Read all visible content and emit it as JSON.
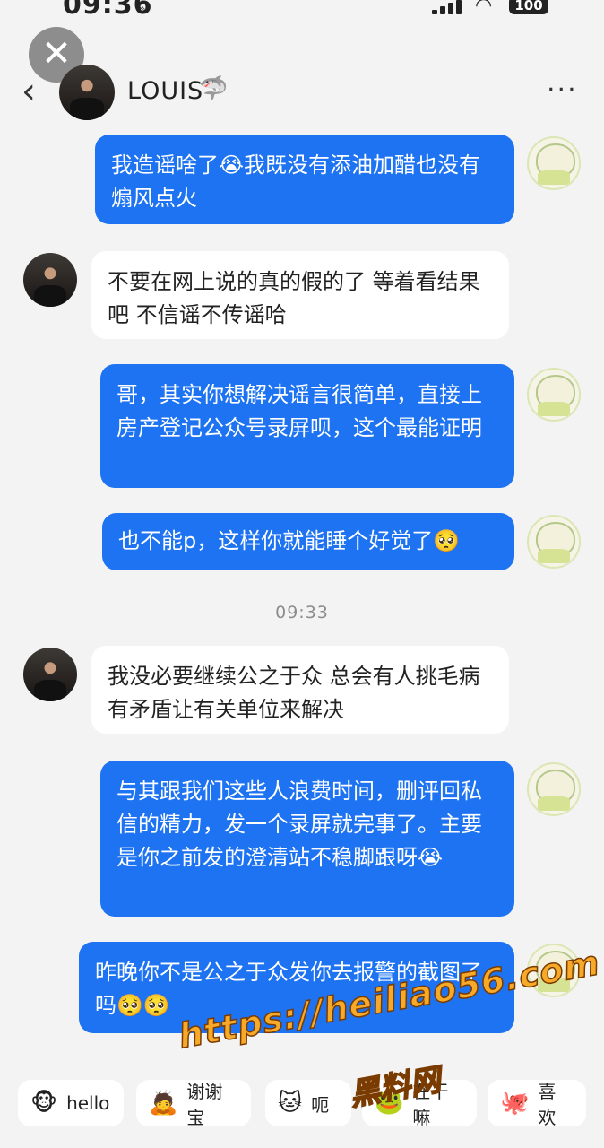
{
  "status_bar": {
    "time": "09:36",
    "battery": "100"
  },
  "header": {
    "contact_name": "LOUIS",
    "name_emoji": "🦈",
    "more": "···",
    "back": "‹",
    "close": "✕"
  },
  "messages": [
    {
      "direction": "out",
      "text": "我造谣啥了",
      "emoji": "😭",
      "text2": "我既没有添油加醋也没有煽风点火"
    },
    {
      "direction": "in",
      "text": "不要在网上说的真的假的了 等着看结果吧 不信谣不传谣哈"
    },
    {
      "direction": "out",
      "text": "哥，其实你想解决谣言很简单，直接上房产登记公众号录屏呗，这个最能证明"
    },
    {
      "direction": "out",
      "text": "也不能p，这样你就能睡个好觉了",
      "emoji": "🥺"
    },
    {
      "direction": "in",
      "text": "我没必要继续公之于众 总会有人挑毛病 有矛盾让有关单位来解决"
    },
    {
      "direction": "out",
      "text": "与其跟我们这些人浪费时间，删评回私信的精力，发一个录屏就完事了。主要是你之前发的澄清站不稳脚跟呀",
      "emoji": "😭"
    },
    {
      "direction": "out",
      "text": "昨晚你不是公之于众发你去报警的截图了吗",
      "emoji": "🥺🥺"
    }
  ],
  "timestamp": "09:33",
  "quick_replies": [
    {
      "icon": "🐵",
      "label": "hello"
    },
    {
      "icon": "🙇",
      "label": "谢谢宝"
    },
    {
      "icon": "🐱",
      "label": "呃"
    },
    {
      "icon": "🐸",
      "label": "在干嘛"
    },
    {
      "icon": "🐙",
      "label": "喜欢"
    }
  ],
  "watermark": {
    "url": "https://heiliao56.com",
    "name": "黑料网"
  }
}
